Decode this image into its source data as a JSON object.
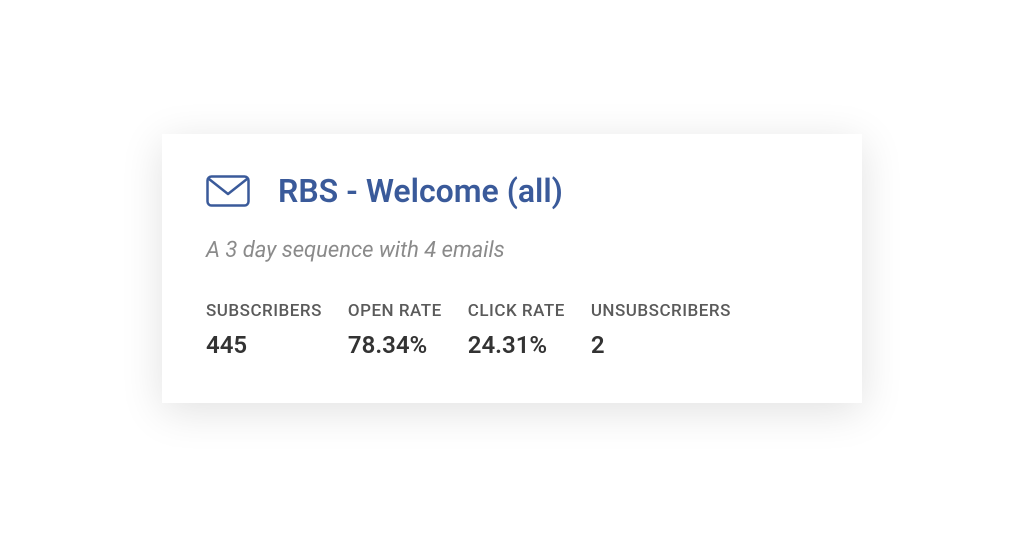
{
  "card": {
    "title": "RBS - Welcome (all)",
    "subtitle": "A 3 day sequence with 4 emails",
    "stats": {
      "subscribers": {
        "label": "SUBSCRIBERS",
        "value": "445"
      },
      "open_rate": {
        "label": "OPEN RATE",
        "value": "78.34%"
      },
      "click_rate": {
        "label": "CLICK RATE",
        "value": "24.31%"
      },
      "unsubscribers": {
        "label": "UNSUBSCRIBERS",
        "value": "2"
      }
    }
  },
  "colors": {
    "accent": "#3a5a9a",
    "subtitle": "#8a8a8a",
    "label": "#5a5a5a",
    "value": "#333333"
  }
}
